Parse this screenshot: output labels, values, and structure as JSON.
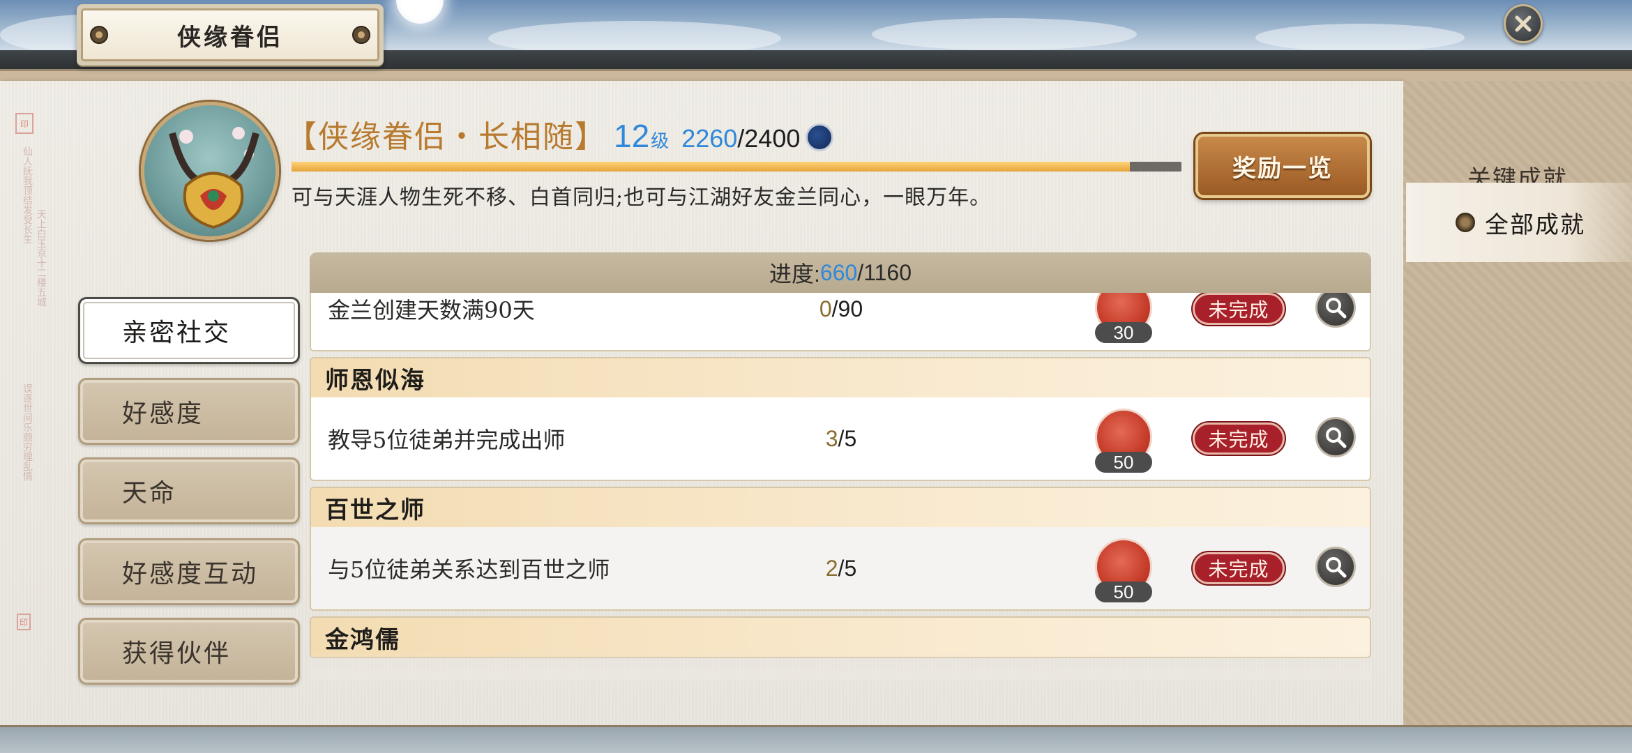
{
  "window": {
    "title": "侠缘眷侣",
    "close_icon": "close-icon"
  },
  "header": {
    "achievement_name": "【侠缘眷侣・长相随】",
    "level": "12",
    "level_unit": "级",
    "exp_current": "2260",
    "exp_max": "/2400",
    "exp_fraction": 0.942,
    "description": "可与天涯人物生死不移、白首同归;也可与江湖好友金兰同心，一眼万年。",
    "reward_button": "奖励一览"
  },
  "categories": [
    {
      "label": "亲密社交",
      "active": true
    },
    {
      "label": "好感度",
      "active": false
    },
    {
      "label": "天命",
      "active": false
    },
    {
      "label": "好感度互动",
      "active": false
    },
    {
      "label": "获得伙伴",
      "active": false
    }
  ],
  "progress": {
    "label": "进度:",
    "current": "660",
    "total": "/1160"
  },
  "groups": [
    {
      "title": "",
      "rows": [
        {
          "task": "金兰创建天数满90天",
          "cur": "0",
          "max": "/90",
          "reward": "30",
          "status": "未完成"
        }
      ]
    },
    {
      "title": "师恩似海",
      "rows": [
        {
          "task": "教导5位徒弟并完成出师",
          "cur": "3",
          "max": "/5",
          "reward": "50",
          "status": "未完成"
        }
      ]
    },
    {
      "title": "百世之师",
      "rows": [
        {
          "task": "与5位徒弟关系达到百世之师",
          "cur": "2",
          "max": "/5",
          "reward": "50",
          "status": "未完成"
        }
      ]
    },
    {
      "title": "金鸿儒",
      "rows": []
    }
  ],
  "right_menu": [
    {
      "label": "关键成就",
      "active": false
    },
    {
      "label": "全部成就",
      "active": true
    }
  ],
  "colors": {
    "accent_blue": "#2f88d9",
    "title_gold": "#b77a2e",
    "status_red": "#a8202a",
    "exp_fill": "#e6a43a"
  }
}
